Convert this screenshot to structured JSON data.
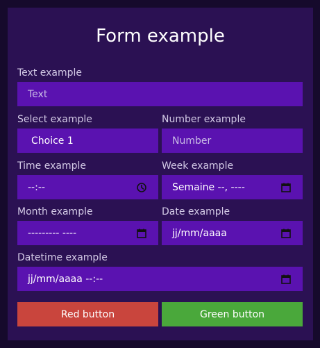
{
  "title": "Form example",
  "text_field": {
    "label": "Text example",
    "placeholder": "Text"
  },
  "select_field": {
    "label": "Select example",
    "value": "Choice 1"
  },
  "number_field": {
    "label": "Number example",
    "placeholder": "Number"
  },
  "time_field": {
    "label": "Time example",
    "value": "--:--",
    "icon": "clock-icon"
  },
  "week_field": {
    "label": "Week example",
    "value": "Semaine --, ----",
    "icon": "calendar-icon"
  },
  "month_field": {
    "label": "Month example",
    "value": "--------- ----",
    "icon": "calendar-icon"
  },
  "date_field": {
    "label": "Date example",
    "value": "jj/mm/aaaa",
    "icon": "calendar-icon"
  },
  "datetime_field": {
    "label": "Datetime example",
    "value": "jj/mm/aaaa --:--",
    "icon": "calendar-icon"
  },
  "buttons": {
    "red": {
      "label": "Red button",
      "color": "#c9453d"
    },
    "green": {
      "label": "Green button",
      "color": "#4aa83b"
    }
  },
  "colors": {
    "background": "#160a2c",
    "card": "#2b1153",
    "field": "#5a12b0",
    "label": "#d3cae6"
  }
}
